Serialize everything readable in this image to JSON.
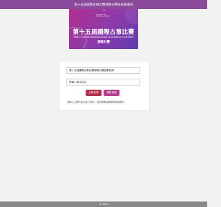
{
  "header": {
    "title": "第十五屆國際古箏比賽湖南分賽區結果查詢"
  },
  "banner": {
    "logo_mark": "⌒",
    "logo_text": "INTERNATIONAL GUZHENG CONTEST",
    "title_cn": "第十五屆國際古箏比賽",
    "title_en": "THE 15TH INTERNATIONAL GUZHENG CONTEST",
    "region": "湖南分賽"
  },
  "form": {
    "competition_value": "第十五屆國際古箏比賽湖南分賽結果查詢",
    "name_placeholder": "請輸入選手姓名",
    "submit_label": "立即查詢",
    "reset_label": "重新來過",
    "note": "請輸入正確的姓名進行查詢，如有疑問請聯繫賽事組委會。"
  },
  "footer": {
    "copyright": "© 2022"
  },
  "colors": {
    "topbar": "#8a4a9c",
    "primary_button": "#b42c4a",
    "reset_button": "#b53a8a",
    "footer": "#888888"
  }
}
